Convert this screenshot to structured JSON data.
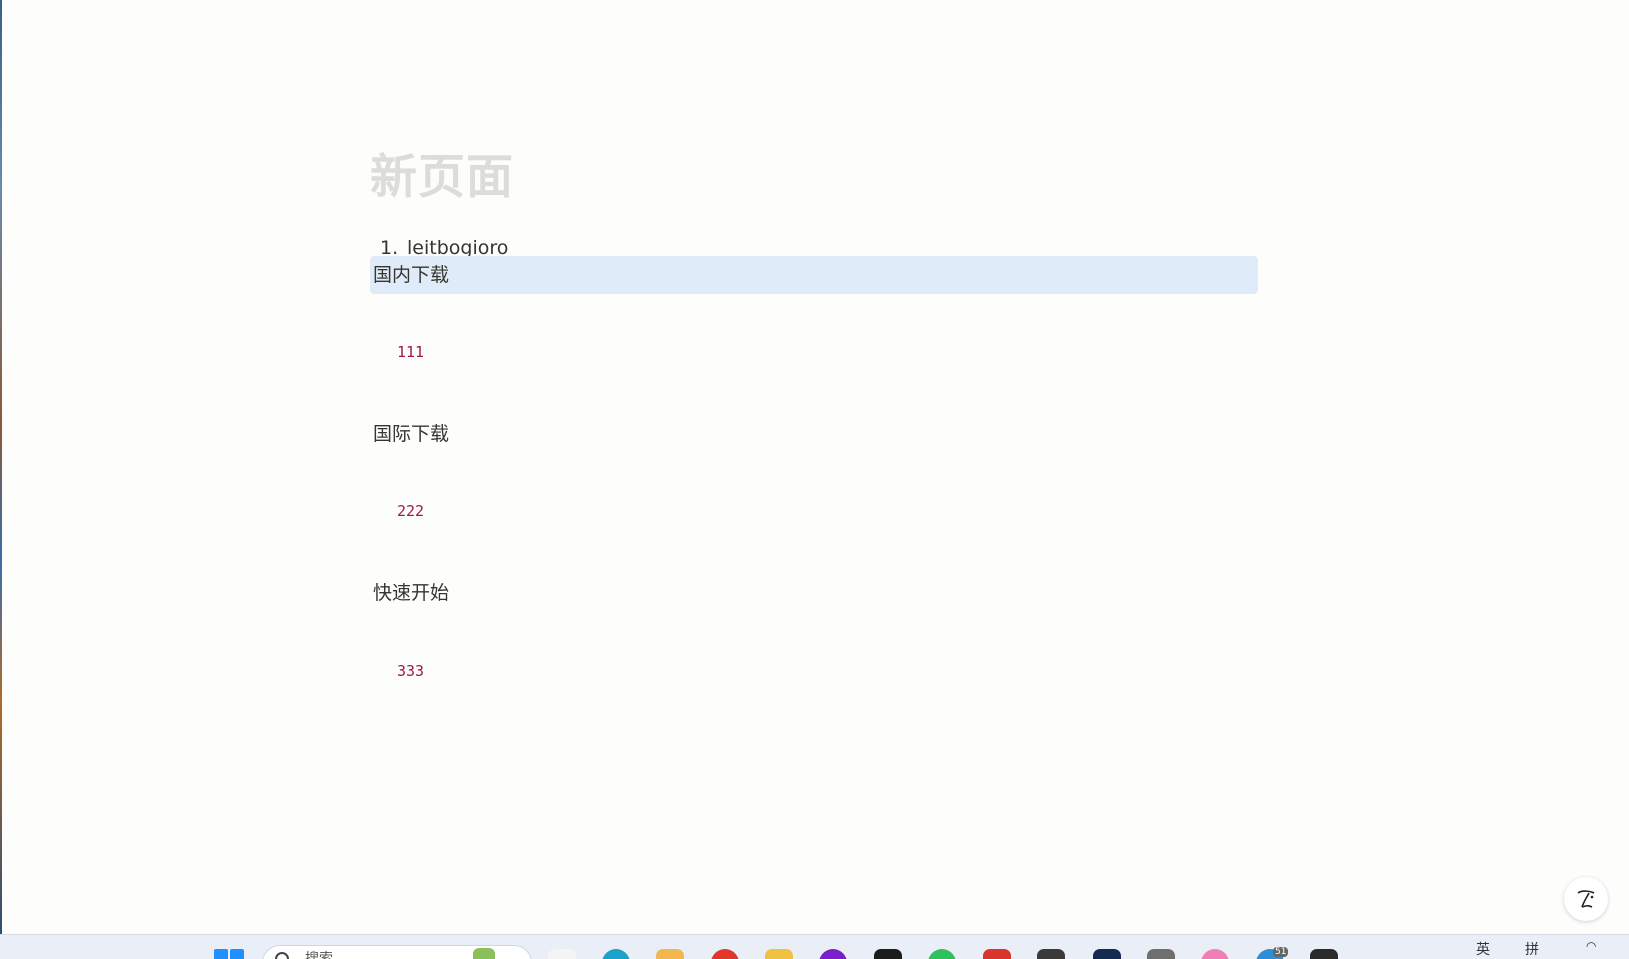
{
  "page": {
    "title": "新页面",
    "list_items": [
      {
        "number": "1.",
        "text": "leitbogioro"
      }
    ],
    "blocks": [
      {
        "heading": "国内下载",
        "code": "111",
        "selected": true
      },
      {
        "heading": "国际下载",
        "code": "222",
        "selected": false
      },
      {
        "heading": "快速开始",
        "code": "333",
        "selected": false
      }
    ]
  },
  "help_button": {
    "icon": "editor-logo-icon"
  },
  "taskbar": {
    "search": {
      "placeholder": "搜索"
    },
    "tray": {
      "input_mode": "英",
      "extra": "拼"
    },
    "badge": "51",
    "apps": [
      {
        "name": "start-icon",
        "color": "#1e90ff"
      },
      {
        "name": "task-view-icon",
        "color": "#f4f4f4"
      },
      {
        "name": "edge-browser-icon",
        "color": "#1aa3c8"
      },
      {
        "name": "file-explorer-icon",
        "color": "#f2b84b"
      },
      {
        "name": "red-app-icon",
        "color": "#e2382b"
      },
      {
        "name": "yellow-app-icon",
        "color": "#f0c040"
      },
      {
        "name": "purple-app-icon",
        "color": "#7a1fc9"
      },
      {
        "name": "black-app-icon",
        "color": "#1c1c1c"
      },
      {
        "name": "wechat-icon",
        "color": "#2fc25b"
      },
      {
        "name": "red-white-app-icon",
        "color": "#d9352b"
      },
      {
        "name": "dark-app-icon",
        "color": "#3a3a3a"
      },
      {
        "name": "navy-app-icon",
        "color": "#152a52"
      },
      {
        "name": "gray-app-icon",
        "color": "#6f6f6f"
      },
      {
        "name": "pink-app-icon",
        "color": "#ef7fb6"
      },
      {
        "name": "blue-badge-app-icon",
        "color": "#2b8fd8"
      },
      {
        "name": "notepad-icon",
        "color": "#2a2a2a"
      }
    ]
  }
}
